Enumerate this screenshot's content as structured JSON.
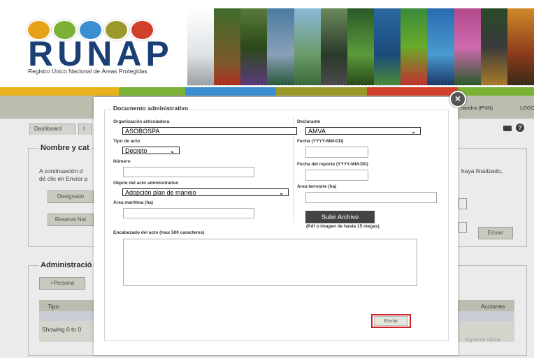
{
  "logo": {
    "text": "RUNAP",
    "subtitle": "Registro Único Nacional de Áreas Protegidas"
  },
  "colors": {
    "brand_blue": "#1b3f74",
    "highlight_red": "#d0202a"
  },
  "header": {
    "user": "Sandra (PNN)",
    "logout": "LOGO"
  },
  "tabs": [
    "Dashboard",
    "I"
  ],
  "background": {
    "section1_title": "Nombre y cat",
    "section1_text_1": "A continuación d",
    "section1_text_2": "dé clic en Enviar p",
    "section1_text_right": "haya finalizado,",
    "btn_designado": "Designado",
    "btn_reserva": "Reserva Nat",
    "btn_enviar": "Enviar",
    "section2_title": "Administració",
    "btn_persona": "+Persona",
    "col_tipo": "Tipo",
    "col_acciones": "Acciones",
    "showing": "Showing 0 to 0",
    "pager": "Siguiente   Última"
  },
  "modal": {
    "legend": "Documento administrativo",
    "close_icon": "close-icon",
    "org_label": "Organización articuladora",
    "org_value": "ASOBOSPA",
    "declarante_label": "Declarante",
    "declarante_value": "AMVA",
    "tipo_label": "Tipo de acto",
    "tipo_value": "Decreto",
    "fecha_label": "Fecha (YYYY-MM-DD)",
    "numero_label": "Número",
    "fecha_reporte_label": "Fecha del reporte (YYYY-MM-DD)",
    "objeto_label": "Objeto del acto administrativo",
    "objeto_value": "Adopción plan de manejo",
    "area_terrestre_label": "Área terrestre (ha)",
    "area_maritima_label": "Área marítima (ha)",
    "upload_label": "Subir Archivo",
    "upload_hint": "(Pdf o imagen de hasta 15 megas)",
    "encabezado_label": "Encabezado del acto (max 500 caracteres)",
    "submit_label": "Enviar"
  }
}
